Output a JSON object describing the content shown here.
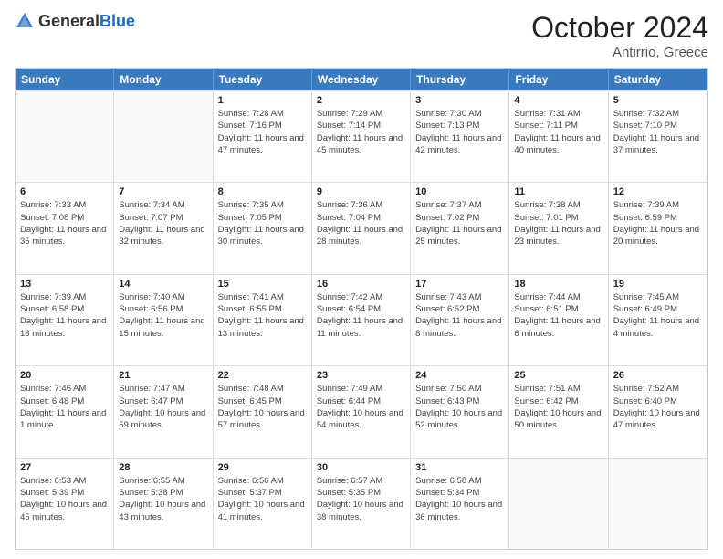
{
  "logo": {
    "general": "General",
    "blue": "Blue"
  },
  "title": {
    "month": "October 2024",
    "location": "Antirrio, Greece"
  },
  "days_of_week": [
    "Sunday",
    "Monday",
    "Tuesday",
    "Wednesday",
    "Thursday",
    "Friday",
    "Saturday"
  ],
  "rows": [
    [
      {
        "day": "",
        "sunrise": "",
        "sunset": "",
        "daylight": "",
        "empty": true
      },
      {
        "day": "",
        "sunrise": "",
        "sunset": "",
        "daylight": "",
        "empty": true
      },
      {
        "day": "1",
        "sunrise": "Sunrise: 7:28 AM",
        "sunset": "Sunset: 7:16 PM",
        "daylight": "Daylight: 11 hours and 47 minutes.",
        "empty": false
      },
      {
        "day": "2",
        "sunrise": "Sunrise: 7:29 AM",
        "sunset": "Sunset: 7:14 PM",
        "daylight": "Daylight: 11 hours and 45 minutes.",
        "empty": false
      },
      {
        "day": "3",
        "sunrise": "Sunrise: 7:30 AM",
        "sunset": "Sunset: 7:13 PM",
        "daylight": "Daylight: 11 hours and 42 minutes.",
        "empty": false
      },
      {
        "day": "4",
        "sunrise": "Sunrise: 7:31 AM",
        "sunset": "Sunset: 7:11 PM",
        "daylight": "Daylight: 11 hours and 40 minutes.",
        "empty": false
      },
      {
        "day": "5",
        "sunrise": "Sunrise: 7:32 AM",
        "sunset": "Sunset: 7:10 PM",
        "daylight": "Daylight: 11 hours and 37 minutes.",
        "empty": false
      }
    ],
    [
      {
        "day": "6",
        "sunrise": "Sunrise: 7:33 AM",
        "sunset": "Sunset: 7:08 PM",
        "daylight": "Daylight: 11 hours and 35 minutes.",
        "empty": false
      },
      {
        "day": "7",
        "sunrise": "Sunrise: 7:34 AM",
        "sunset": "Sunset: 7:07 PM",
        "daylight": "Daylight: 11 hours and 32 minutes.",
        "empty": false
      },
      {
        "day": "8",
        "sunrise": "Sunrise: 7:35 AM",
        "sunset": "Sunset: 7:05 PM",
        "daylight": "Daylight: 11 hours and 30 minutes.",
        "empty": false
      },
      {
        "day": "9",
        "sunrise": "Sunrise: 7:36 AM",
        "sunset": "Sunset: 7:04 PM",
        "daylight": "Daylight: 11 hours and 28 minutes.",
        "empty": false
      },
      {
        "day": "10",
        "sunrise": "Sunrise: 7:37 AM",
        "sunset": "Sunset: 7:02 PM",
        "daylight": "Daylight: 11 hours and 25 minutes.",
        "empty": false
      },
      {
        "day": "11",
        "sunrise": "Sunrise: 7:38 AM",
        "sunset": "Sunset: 7:01 PM",
        "daylight": "Daylight: 11 hours and 23 minutes.",
        "empty": false
      },
      {
        "day": "12",
        "sunrise": "Sunrise: 7:39 AM",
        "sunset": "Sunset: 6:59 PM",
        "daylight": "Daylight: 11 hours and 20 minutes.",
        "empty": false
      }
    ],
    [
      {
        "day": "13",
        "sunrise": "Sunrise: 7:39 AM",
        "sunset": "Sunset: 6:58 PM",
        "daylight": "Daylight: 11 hours and 18 minutes.",
        "empty": false
      },
      {
        "day": "14",
        "sunrise": "Sunrise: 7:40 AM",
        "sunset": "Sunset: 6:56 PM",
        "daylight": "Daylight: 11 hours and 15 minutes.",
        "empty": false
      },
      {
        "day": "15",
        "sunrise": "Sunrise: 7:41 AM",
        "sunset": "Sunset: 6:55 PM",
        "daylight": "Daylight: 11 hours and 13 minutes.",
        "empty": false
      },
      {
        "day": "16",
        "sunrise": "Sunrise: 7:42 AM",
        "sunset": "Sunset: 6:54 PM",
        "daylight": "Daylight: 11 hours and 11 minutes.",
        "empty": false
      },
      {
        "day": "17",
        "sunrise": "Sunrise: 7:43 AM",
        "sunset": "Sunset: 6:52 PM",
        "daylight": "Daylight: 11 hours and 8 minutes.",
        "empty": false
      },
      {
        "day": "18",
        "sunrise": "Sunrise: 7:44 AM",
        "sunset": "Sunset: 6:51 PM",
        "daylight": "Daylight: 11 hours and 6 minutes.",
        "empty": false
      },
      {
        "day": "19",
        "sunrise": "Sunrise: 7:45 AM",
        "sunset": "Sunset: 6:49 PM",
        "daylight": "Daylight: 11 hours and 4 minutes.",
        "empty": false
      }
    ],
    [
      {
        "day": "20",
        "sunrise": "Sunrise: 7:46 AM",
        "sunset": "Sunset: 6:48 PM",
        "daylight": "Daylight: 11 hours and 1 minute.",
        "empty": false
      },
      {
        "day": "21",
        "sunrise": "Sunrise: 7:47 AM",
        "sunset": "Sunset: 6:47 PM",
        "daylight": "Daylight: 10 hours and 59 minutes.",
        "empty": false
      },
      {
        "day": "22",
        "sunrise": "Sunrise: 7:48 AM",
        "sunset": "Sunset: 6:45 PM",
        "daylight": "Daylight: 10 hours and 57 minutes.",
        "empty": false
      },
      {
        "day": "23",
        "sunrise": "Sunrise: 7:49 AM",
        "sunset": "Sunset: 6:44 PM",
        "daylight": "Daylight: 10 hours and 54 minutes.",
        "empty": false
      },
      {
        "day": "24",
        "sunrise": "Sunrise: 7:50 AM",
        "sunset": "Sunset: 6:43 PM",
        "daylight": "Daylight: 10 hours and 52 minutes.",
        "empty": false
      },
      {
        "day": "25",
        "sunrise": "Sunrise: 7:51 AM",
        "sunset": "Sunset: 6:42 PM",
        "daylight": "Daylight: 10 hours and 50 minutes.",
        "empty": false
      },
      {
        "day": "26",
        "sunrise": "Sunrise: 7:52 AM",
        "sunset": "Sunset: 6:40 PM",
        "daylight": "Daylight: 10 hours and 47 minutes.",
        "empty": false
      }
    ],
    [
      {
        "day": "27",
        "sunrise": "Sunrise: 6:53 AM",
        "sunset": "Sunset: 5:39 PM",
        "daylight": "Daylight: 10 hours and 45 minutes.",
        "empty": false
      },
      {
        "day": "28",
        "sunrise": "Sunrise: 6:55 AM",
        "sunset": "Sunset: 5:38 PM",
        "daylight": "Daylight: 10 hours and 43 minutes.",
        "empty": false
      },
      {
        "day": "29",
        "sunrise": "Sunrise: 6:56 AM",
        "sunset": "Sunset: 5:37 PM",
        "daylight": "Daylight: 10 hours and 41 minutes.",
        "empty": false
      },
      {
        "day": "30",
        "sunrise": "Sunrise: 6:57 AM",
        "sunset": "Sunset: 5:35 PM",
        "daylight": "Daylight: 10 hours and 38 minutes.",
        "empty": false
      },
      {
        "day": "31",
        "sunrise": "Sunrise: 6:58 AM",
        "sunset": "Sunset: 5:34 PM",
        "daylight": "Daylight: 10 hours and 36 minutes.",
        "empty": false
      },
      {
        "day": "",
        "sunrise": "",
        "sunset": "",
        "daylight": "",
        "empty": true
      },
      {
        "day": "",
        "sunrise": "",
        "sunset": "",
        "daylight": "",
        "empty": true
      }
    ]
  ]
}
